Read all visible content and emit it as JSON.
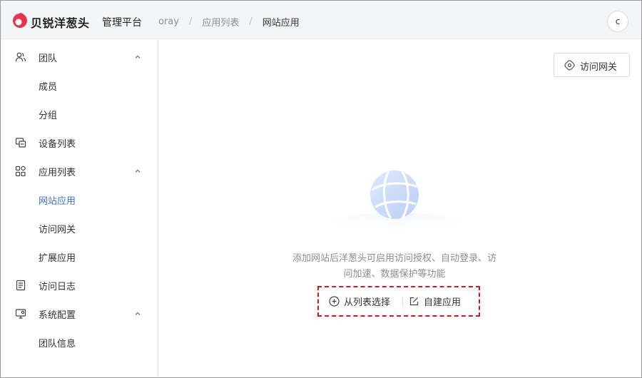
{
  "header": {
    "brand": "贝锐洋葱头",
    "subtitle": "管理平台",
    "breadcrumbs": [
      "oray",
      "应用列表",
      "网站应用"
    ],
    "separator": "/",
    "avatar_initial": "c"
  },
  "sidebar": {
    "items": [
      {
        "label": "团队",
        "icon": "team-icon",
        "expanded": true
      },
      {
        "label": "成员"
      },
      {
        "label": "分组"
      },
      {
        "label": "设备列表",
        "icon": "device-icon"
      },
      {
        "label": "应用列表",
        "icon": "apps-icon",
        "expanded": true
      },
      {
        "label": "网站应用",
        "active": true
      },
      {
        "label": "访问网关"
      },
      {
        "label": "扩展应用"
      },
      {
        "label": "访问日志",
        "icon": "log-icon"
      },
      {
        "label": "系统配置",
        "icon": "settings-icon",
        "expanded": true
      },
      {
        "label": "团队信息"
      }
    ]
  },
  "main": {
    "gateway_button": "访问网关",
    "empty_line1": "添加网站后洋葱头可启用访问授权、自动登录、访",
    "empty_line2": "问加速、数据保护等功能",
    "action_select": "从列表选择",
    "action_create": "自建应用"
  },
  "colors": {
    "accent": "#3f6fe0",
    "brand": "#e8334a",
    "highlight_border": "#d9161e"
  }
}
